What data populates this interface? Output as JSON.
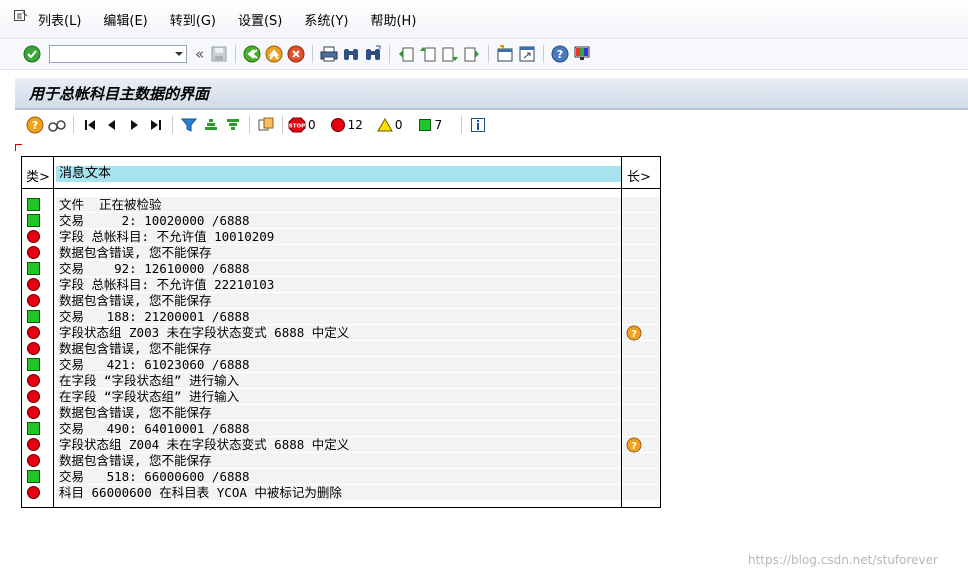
{
  "menu": {
    "items": [
      "列表(L)",
      "编辑(E)",
      "转到(G)",
      "设置(S)",
      "系统(Y)",
      "帮助(H)"
    ]
  },
  "toolbar": {
    "command_value": "",
    "back_glyph": "«"
  },
  "screen": {
    "title": "用于总帐科目主数据的界面"
  },
  "app_toolbar": {
    "stop_count": "0",
    "error_count": "12",
    "warning_count": "0",
    "success_count": "7"
  },
  "table": {
    "header_type": "类>",
    "header_text": "消息文本",
    "header_len": "长>",
    "rows": [
      {
        "type": "green",
        "text": "文件  正在被检验",
        "info": false
      },
      {
        "type": "green",
        "text": "交易     2: 10020000 /6888",
        "info": false
      },
      {
        "type": "red",
        "text": "字段 总帐科目: 不允许值 10010209",
        "info": false
      },
      {
        "type": "red",
        "text": "数据包含错误, 您不能保存",
        "info": false
      },
      {
        "type": "green",
        "text": "交易    92: 12610000 /6888",
        "info": false
      },
      {
        "type": "red",
        "text": "字段 总帐科目: 不允许值 22210103",
        "info": false
      },
      {
        "type": "red",
        "text": "数据包含错误, 您不能保存",
        "info": false
      },
      {
        "type": "green",
        "text": "交易   188: 21200001 /6888",
        "info": false
      },
      {
        "type": "red",
        "text": "字段状态组 Z003 未在字段状态变式 6888 中定义",
        "info": true
      },
      {
        "type": "red",
        "text": "数据包含错误, 您不能保存",
        "info": false
      },
      {
        "type": "green",
        "text": "交易   421: 61023060 /6888",
        "info": false
      },
      {
        "type": "red",
        "text": "在字段 “字段状态组” 进行输入",
        "info": false
      },
      {
        "type": "red",
        "text": "在字段 “字段状态组” 进行输入",
        "info": false
      },
      {
        "type": "red",
        "text": "数据包含错误, 您不能保存",
        "info": false
      },
      {
        "type": "green",
        "text": "交易   490: 64010001 /6888",
        "info": false
      },
      {
        "type": "red",
        "text": "字段状态组 Z004 未在字段状态变式 6888 中定义",
        "info": true
      },
      {
        "type": "red",
        "text": "数据包含错误, 您不能保存",
        "info": false
      },
      {
        "type": "green",
        "text": "交易   518: 66000600 /6888",
        "info": false
      },
      {
        "type": "red",
        "text": "科目 66000600 在科目表 YCOA 中被标记为删除",
        "info": false
      }
    ]
  },
  "watermark": "https://blog.csdn.net/stuforever",
  "colors": {
    "header_highlight": "#a7e3ee",
    "success_green": "#22c42a",
    "error_red": "#e60012",
    "info_orange": "#f4a21a"
  }
}
